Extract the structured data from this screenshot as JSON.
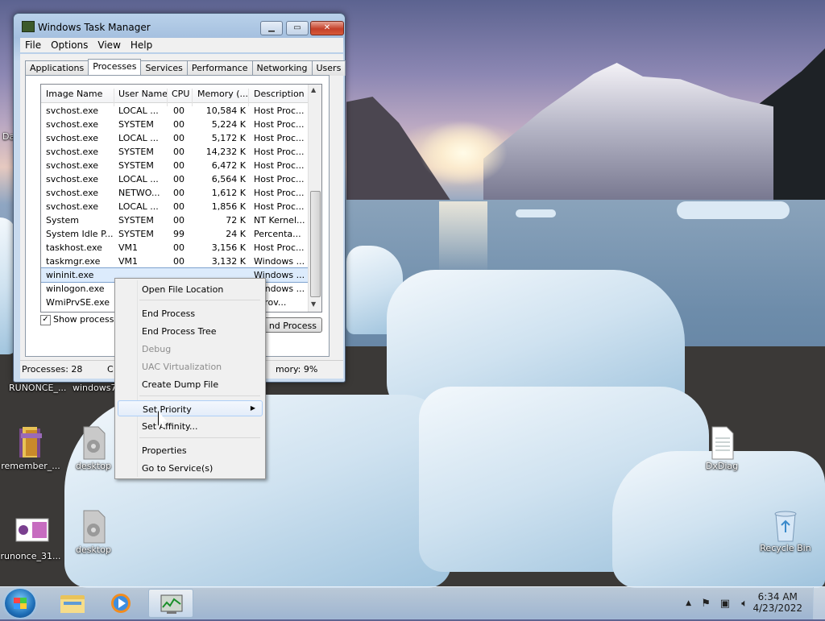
{
  "window": {
    "title": "Windows Task Manager",
    "menu": [
      "File",
      "Options",
      "View",
      "Help"
    ],
    "tabs": [
      "Applications",
      "Processes",
      "Services",
      "Performance",
      "Networking",
      "Users"
    ],
    "active_tab": "Processes",
    "columns": [
      "Image Name",
      "User Name",
      "CPU",
      "Memory (...",
      "Description"
    ],
    "rows": [
      {
        "name": "svchost.exe",
        "user": "LOCAL ...",
        "cpu": "00",
        "mem": "10,584 K",
        "desc": "Host Proc..."
      },
      {
        "name": "svchost.exe",
        "user": "SYSTEM",
        "cpu": "00",
        "mem": "5,224 K",
        "desc": "Host Proc..."
      },
      {
        "name": "svchost.exe",
        "user": "LOCAL ...",
        "cpu": "00",
        "mem": "5,172 K",
        "desc": "Host Proc..."
      },
      {
        "name": "svchost.exe",
        "user": "SYSTEM",
        "cpu": "00",
        "mem": "14,232 K",
        "desc": "Host Proc..."
      },
      {
        "name": "svchost.exe",
        "user": "SYSTEM",
        "cpu": "00",
        "mem": "6,472 K",
        "desc": "Host Proc..."
      },
      {
        "name": "svchost.exe",
        "user": "LOCAL ...",
        "cpu": "00",
        "mem": "6,564 K",
        "desc": "Host Proc..."
      },
      {
        "name": "svchost.exe",
        "user": "NETWO...",
        "cpu": "00",
        "mem": "1,612 K",
        "desc": "Host Proc..."
      },
      {
        "name": "svchost.exe",
        "user": "LOCAL ...",
        "cpu": "00",
        "mem": "1,856 K",
        "desc": "Host Proc..."
      },
      {
        "name": "System",
        "user": "SYSTEM",
        "cpu": "00",
        "mem": "72 K",
        "desc": "NT Kernel..."
      },
      {
        "name": "System Idle P...",
        "user": "SYSTEM",
        "cpu": "99",
        "mem": "24 K",
        "desc": "Percenta..."
      },
      {
        "name": "taskhost.exe",
        "user": "VM1",
        "cpu": "00",
        "mem": "3,156 K",
        "desc": "Host Proc..."
      },
      {
        "name": "taskmgr.exe",
        "user": "VM1",
        "cpu": "00",
        "mem": "3,132 K",
        "desc": "Windows ..."
      },
      {
        "name": "wininit.exe",
        "user": "",
        "cpu": "",
        "mem": "",
        "desc": "Windows ..."
      },
      {
        "name": "winlogon.exe",
        "user": "",
        "cpu": "",
        "mem": "",
        "desc": "Windows ..."
      },
      {
        "name": "WmiPrvSE.exe",
        "user": "",
        "cpu": "",
        "mem": "",
        "desc": "I Prov..."
      }
    ],
    "selected_row": 12,
    "show_processes_label": "Show processes",
    "end_process_label": "nd Process",
    "status": {
      "processes": "Processes: 28",
      "c": "C",
      "memory": "mory: 9%"
    }
  },
  "context_menu": {
    "items": [
      {
        "label": "Open File Location",
        "disabled": false
      },
      {
        "label": "End Process",
        "disabled": false
      },
      {
        "label": "End Process Tree",
        "disabled": false
      },
      {
        "label": "Debug",
        "disabled": true
      },
      {
        "label": "UAC Virtualization",
        "disabled": true
      },
      {
        "label": "Create Dump File",
        "disabled": false
      },
      {
        "label": "Set Priority",
        "disabled": false,
        "submenu": true
      },
      {
        "label": "Set Affinity...",
        "disabled": false
      },
      {
        "label": "Properties",
        "disabled": false
      },
      {
        "label": "Go to Service(s)",
        "disabled": false
      }
    ],
    "hovered": "Set Priority"
  },
  "desktop": {
    "icons": [
      {
        "label": "RUNONCE_..."
      },
      {
        "label": "windows7..."
      },
      {
        "label": "remember_..."
      },
      {
        "label": "desktop"
      },
      {
        "label": "runonce_31..."
      },
      {
        "label": "desktop"
      },
      {
        "label": "DxDiag"
      },
      {
        "label": "Recycle Bin"
      },
      {
        "label": "Da"
      }
    ]
  },
  "taskbar": {
    "time": "6:34 AM",
    "date": "4/23/2022",
    "pinned": [
      "start-orb",
      "explorer",
      "media-player",
      "task-manager"
    ]
  }
}
